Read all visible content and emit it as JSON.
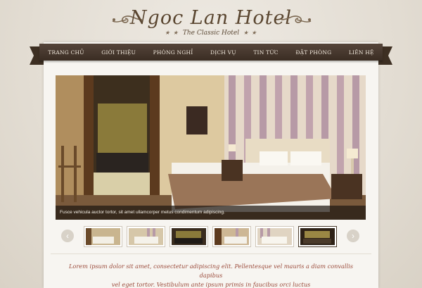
{
  "brand": {
    "title": "Ngoc Lan Hotel",
    "tagline": "The Classic Hotel",
    "stars_left": "★ ★",
    "stars_right": "★ ★"
  },
  "nav": {
    "items": [
      {
        "label": "TRANG CHỦ"
      },
      {
        "label": "GIỚI THIỆU"
      },
      {
        "label": "PHÒNG NGHỈ"
      },
      {
        "label": "DỊCH VỤ"
      },
      {
        "label": "TIN TỨC"
      },
      {
        "label": "ĐẶT PHÒNG"
      },
      {
        "label": "LIÊN HỆ"
      }
    ]
  },
  "slider": {
    "caption": "Fusce vehicula auctor tortor, sit amet ullamcorper metus condimentum adipiscing.",
    "prev_icon": "chevron-left-icon",
    "next_icon": "chevron-right-icon",
    "prev_glyph": "‹",
    "next_glyph": "›",
    "thumbnail_count": 6,
    "active_thumbnail": 6
  },
  "intro": {
    "line1": "Lorem ipsum dolor sit amet, consectetur adipiscing elit. Pellentesque vel mauris a diam convallis dapibus",
    "line2": "vel eget tortor. Vestibulum ante ipsum primis in faucibus orci luctus"
  },
  "colors": {
    "nav_bg": "#3a2d23",
    "intro_text": "#9a4a3a",
    "brand_text": "#5a4630"
  }
}
